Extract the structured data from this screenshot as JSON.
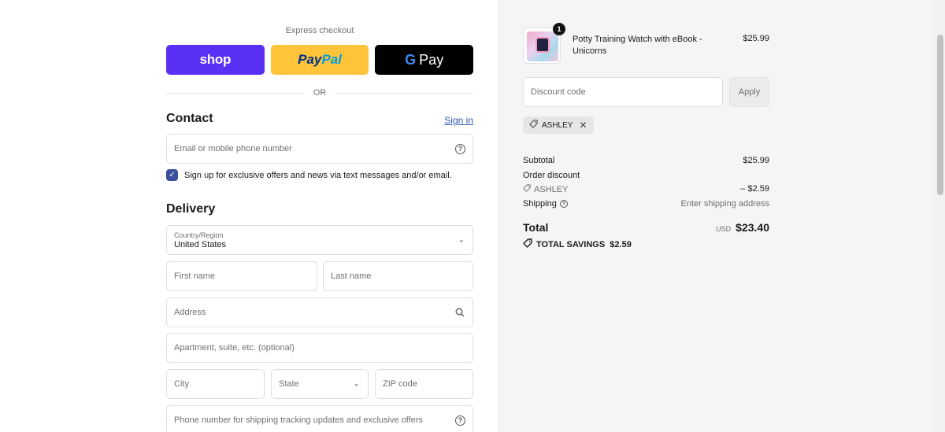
{
  "express": {
    "label": "Express checkout",
    "shop_label": "shop",
    "paypal_a": "Pay",
    "paypal_b": "Pal",
    "gpay_g": "G",
    "gpay_label": "Pay",
    "or_label": "OR"
  },
  "contact": {
    "title": "Contact",
    "signin": "Sign in",
    "email_placeholder": "Email or mobile phone number",
    "signup_text": "Sign up for exclusive offers and news via text messages and/or email."
  },
  "delivery": {
    "title": "Delivery",
    "country_label": "Country/Region",
    "country_value": "United States",
    "first_name": "First name",
    "last_name": "Last name",
    "address": "Address",
    "apartment": "Apartment, suite, etc. (optional)",
    "city": "City",
    "state": "State",
    "zip": "ZIP code",
    "phone": "Phone number for shipping tracking updates and exclusive offers"
  },
  "cart": {
    "quantity": "1",
    "product_name": "Potty Training Watch with eBook - Unicorns",
    "product_price": "$25.99",
    "discount_placeholder": "Discount code",
    "apply_label": "Apply",
    "applied_code": "ASHLEY"
  },
  "summary": {
    "subtotal_label": "Subtotal",
    "subtotal_value": "$25.99",
    "order_discount_label": "Order discount",
    "discount_code": "ASHLEY",
    "discount_value": "– $2.59",
    "shipping_label": "Shipping",
    "shipping_value": "Enter shipping address",
    "total_label": "Total",
    "currency": "USD",
    "total_value": "$23.40",
    "savings": "TOTAL SAVINGS  $2.59"
  },
  "colors": {
    "shop_purple": "#5a31f4",
    "paypal_yellow": "#ffc439",
    "checkbox_blue": "#3a4f9d",
    "link_blue": "#305bb0"
  }
}
